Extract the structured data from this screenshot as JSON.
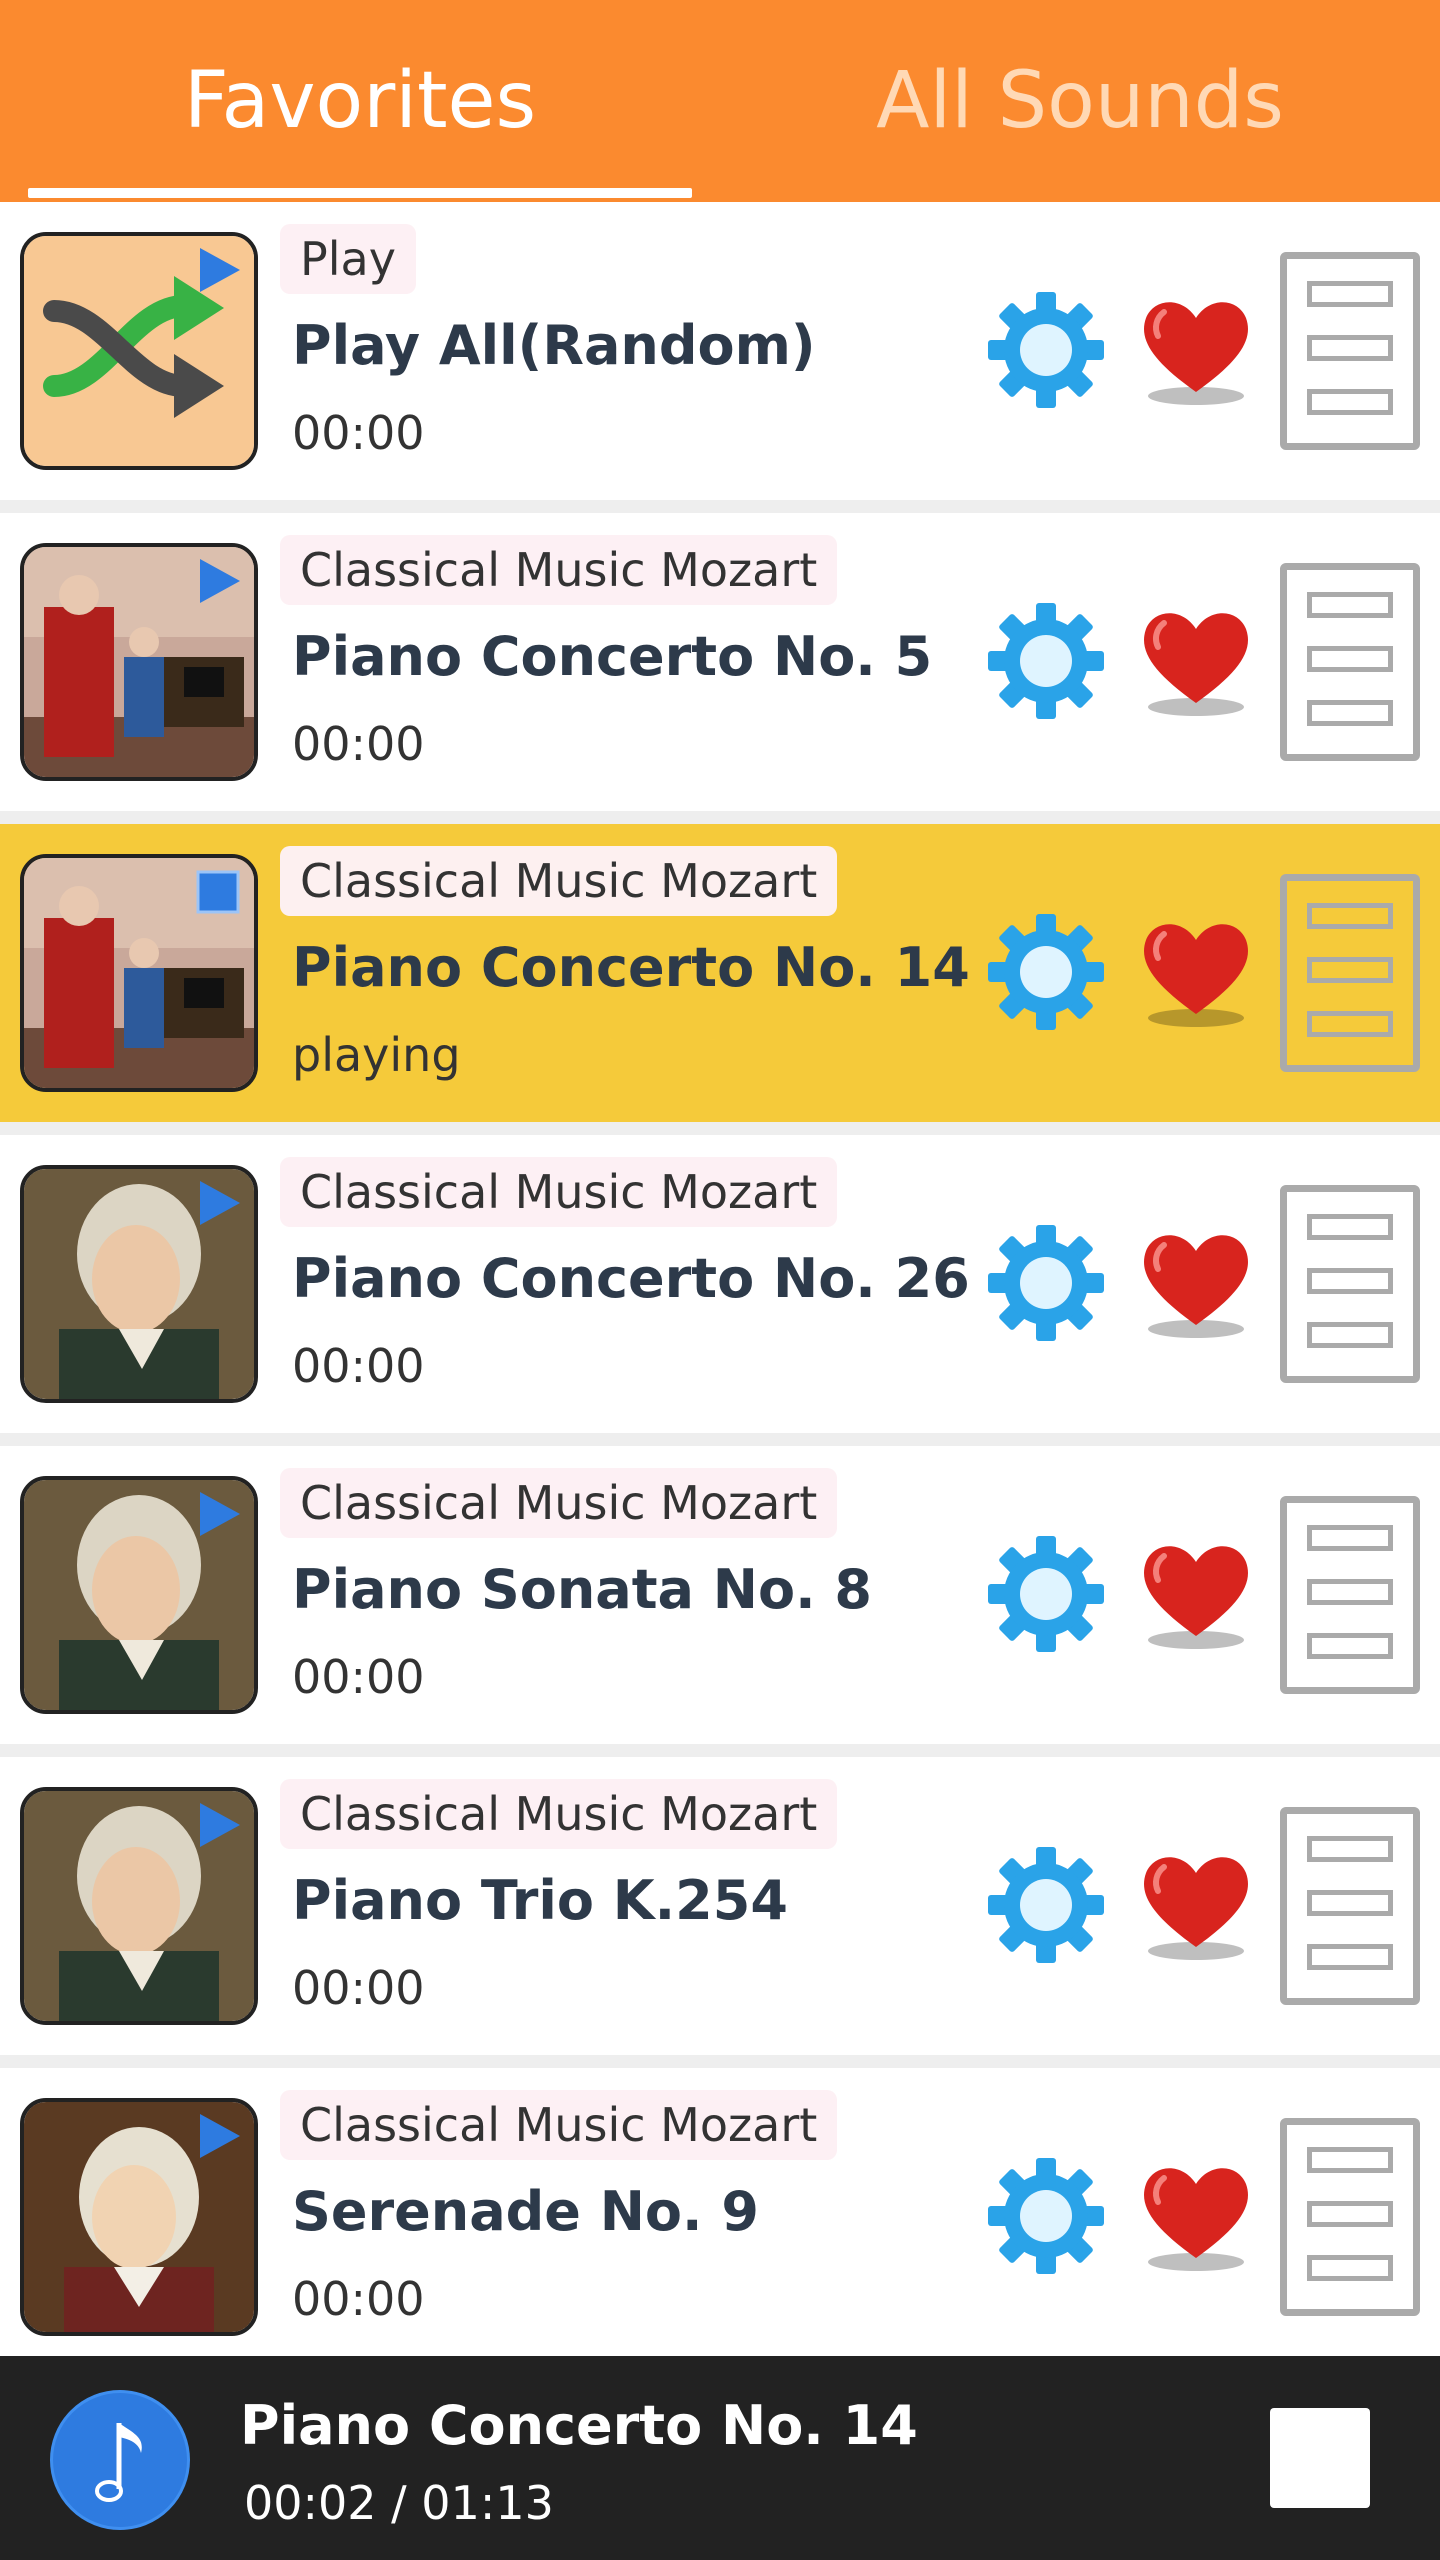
{
  "tabs": {
    "favorites": "Favorites",
    "all_sounds": "All Sounds",
    "active": "favorites"
  },
  "colors": {
    "header_bg": "#FB8A2F",
    "playing_row_bg": "#F5CA3A",
    "player_bg": "#222222",
    "accent_blue": "#2E7BE0"
  },
  "rows": [
    {
      "category": "Play",
      "title": "Play All(Random)",
      "status": "00:00",
      "thumb": "shuffle",
      "playing": false
    },
    {
      "category": "Classical Music Mozart",
      "title": "Piano Concerto No. 5",
      "status": "00:00",
      "thumb": "mozart-family",
      "playing": false
    },
    {
      "category": "Classical Music Mozart",
      "title": "Piano Concerto No. 14",
      "status": "playing",
      "thumb": "mozart-family",
      "playing": true
    },
    {
      "category": "Classical Music Mozart",
      "title": "Piano Concerto No. 26",
      "status": "00:00",
      "thumb": "mozart-portrait",
      "playing": false
    },
    {
      "category": "Classical Music Mozart",
      "title": "Piano Sonata No. 8",
      "status": "00:00",
      "thumb": "mozart-portrait",
      "playing": false
    },
    {
      "category": "Classical Music Mozart",
      "title": "Piano Trio K.254",
      "status": "00:00",
      "thumb": "mozart-portrait",
      "playing": false
    },
    {
      "category": "Classical Music Mozart",
      "title": "Serenade No. 9",
      "status": "00:00",
      "thumb": "mozart-young",
      "playing": false
    }
  ],
  "row_icons": [
    "gear-icon",
    "heart-icon",
    "list-menu-icon"
  ],
  "player": {
    "title": "Piano Concerto No. 14",
    "time": "00:02 / 01:13",
    "icon": "music-note-icon",
    "stop_icon": "stop-icon"
  }
}
